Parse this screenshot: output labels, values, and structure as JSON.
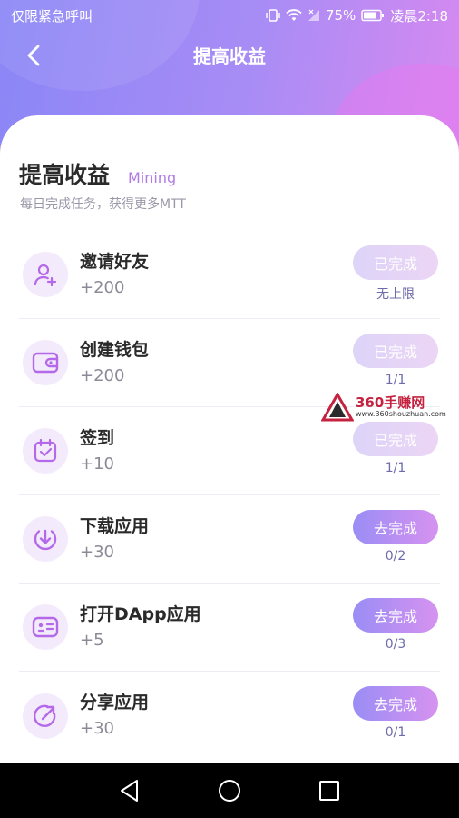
{
  "status_bar": {
    "carrier": "仅限紧急呼叫",
    "battery": "75%",
    "time": "凌晨2:18"
  },
  "header": {
    "title": "提高收益",
    "back_icon": "chevron-left-icon"
  },
  "card": {
    "title": "提高收益",
    "tag": "Mining",
    "subtitle": "每日完成任务，获得更多MTT"
  },
  "tasks": [
    {
      "name": "邀请好友",
      "reward": "+200",
      "button": "已完成",
      "progress": "无上限",
      "state": "done",
      "icon": "user-add-icon"
    },
    {
      "name": "创建钱包",
      "reward": "+200",
      "button": "已完成",
      "progress": "1/1",
      "state": "done",
      "icon": "wallet-icon"
    },
    {
      "name": "签到",
      "reward": "+10",
      "button": "已完成",
      "progress": "1/1",
      "state": "done",
      "icon": "calendar-check-icon"
    },
    {
      "name": "下载应用",
      "reward": "+30",
      "button": "去完成",
      "progress": "0/2",
      "state": "todo",
      "icon": "download-icon"
    },
    {
      "name": "打开DApp应用",
      "reward": "+5",
      "button": "去完成",
      "progress": "0/3",
      "state": "todo",
      "icon": "dapp-icon"
    },
    {
      "name": "分享应用",
      "reward": "+30",
      "button": "去完成",
      "progress": "0/1",
      "state": "todo",
      "icon": "share-icon"
    }
  ],
  "watermark": {
    "name": "360手赚网",
    "url": "www.360shouzhuan.com"
  },
  "colors": {
    "accent": "#b07be6",
    "icon_stroke": "#b46ae8",
    "button_gradient_start": "#9a8df5",
    "button_gradient_end": "#d692f0"
  }
}
